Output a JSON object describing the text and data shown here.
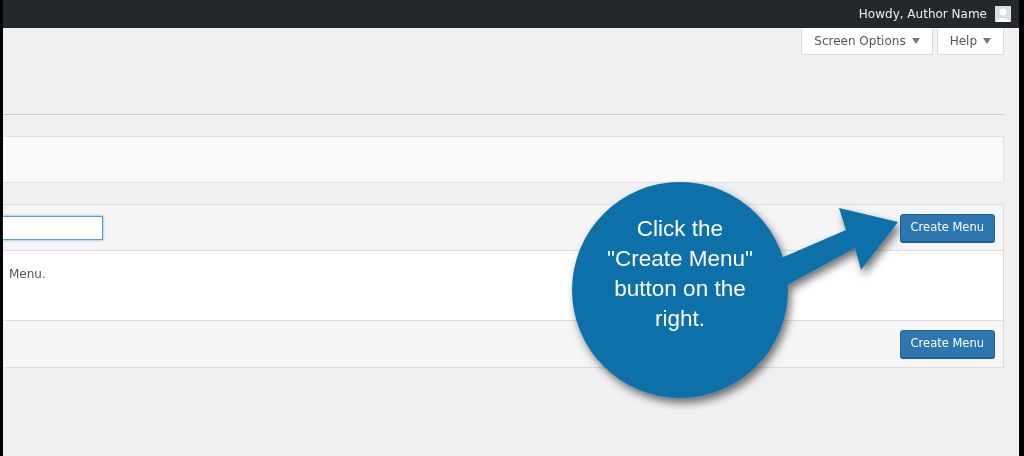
{
  "admin_bar": {
    "greeting": "Howdy, Author Name"
  },
  "screen_tabs": [
    {
      "label": "Screen Options"
    },
    {
      "label": "Help"
    }
  ],
  "menu_panel": {
    "header_button": "Create Menu",
    "body_text": "Menu.",
    "footer_button": "Create Menu"
  },
  "callout": {
    "lines": [
      "Click the",
      "\"Create Menu\"",
      "button on the",
      "right."
    ]
  }
}
